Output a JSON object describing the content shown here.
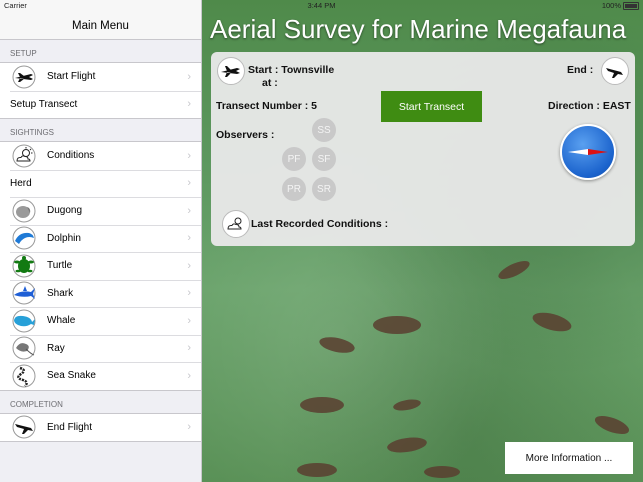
{
  "status_bar": {
    "carrier": "Carrier",
    "time": "3:44 PM",
    "battery": "100%"
  },
  "sidebar": {
    "title": "Main Menu",
    "sections": [
      {
        "title": "SETUP",
        "items": [
          {
            "label": "Start Flight",
            "icon": "airplane-icon"
          },
          {
            "label": "Setup Transect",
            "icon": ""
          }
        ]
      },
      {
        "title": "SIGHTINGS",
        "items": [
          {
            "label": "Conditions",
            "icon": "cloud-sun-icon"
          },
          {
            "label": "Herd",
            "icon": ""
          },
          {
            "label": "Dugong",
            "icon": "dugong-icon"
          },
          {
            "label": "Dolphin",
            "icon": "dolphin-icon"
          },
          {
            "label": "Turtle",
            "icon": "turtle-icon"
          },
          {
            "label": "Shark",
            "icon": "shark-icon"
          },
          {
            "label": "Whale",
            "icon": "whale-icon"
          },
          {
            "label": "Ray",
            "icon": "ray-icon"
          },
          {
            "label": "Sea Snake",
            "icon": "sea-snake-icon"
          }
        ]
      },
      {
        "title": "COMPLETION",
        "items": [
          {
            "label": "End Flight",
            "icon": "airplane-landing-icon"
          }
        ]
      }
    ]
  },
  "main": {
    "title": "Aerial Survey for Marine Megafauna",
    "panel": {
      "start_label": "Start : Townsville",
      "at_label": "at :",
      "end_label": "End :",
      "transect_label": "Transect Number : 5",
      "start_transect_button": "Start Transect",
      "direction_label": "Direction : EAST",
      "observers_label": "Observers :",
      "observers": [
        "SS",
        "PF",
        "SF",
        "PR",
        "SR"
      ],
      "conditions_label": "Last Recorded Conditions :"
    },
    "more_info_button": "More Information ..."
  },
  "colors": {
    "start_button": "#3f8c12",
    "compass": "#1a62cc",
    "observer_badge": "#c9c9c9"
  }
}
